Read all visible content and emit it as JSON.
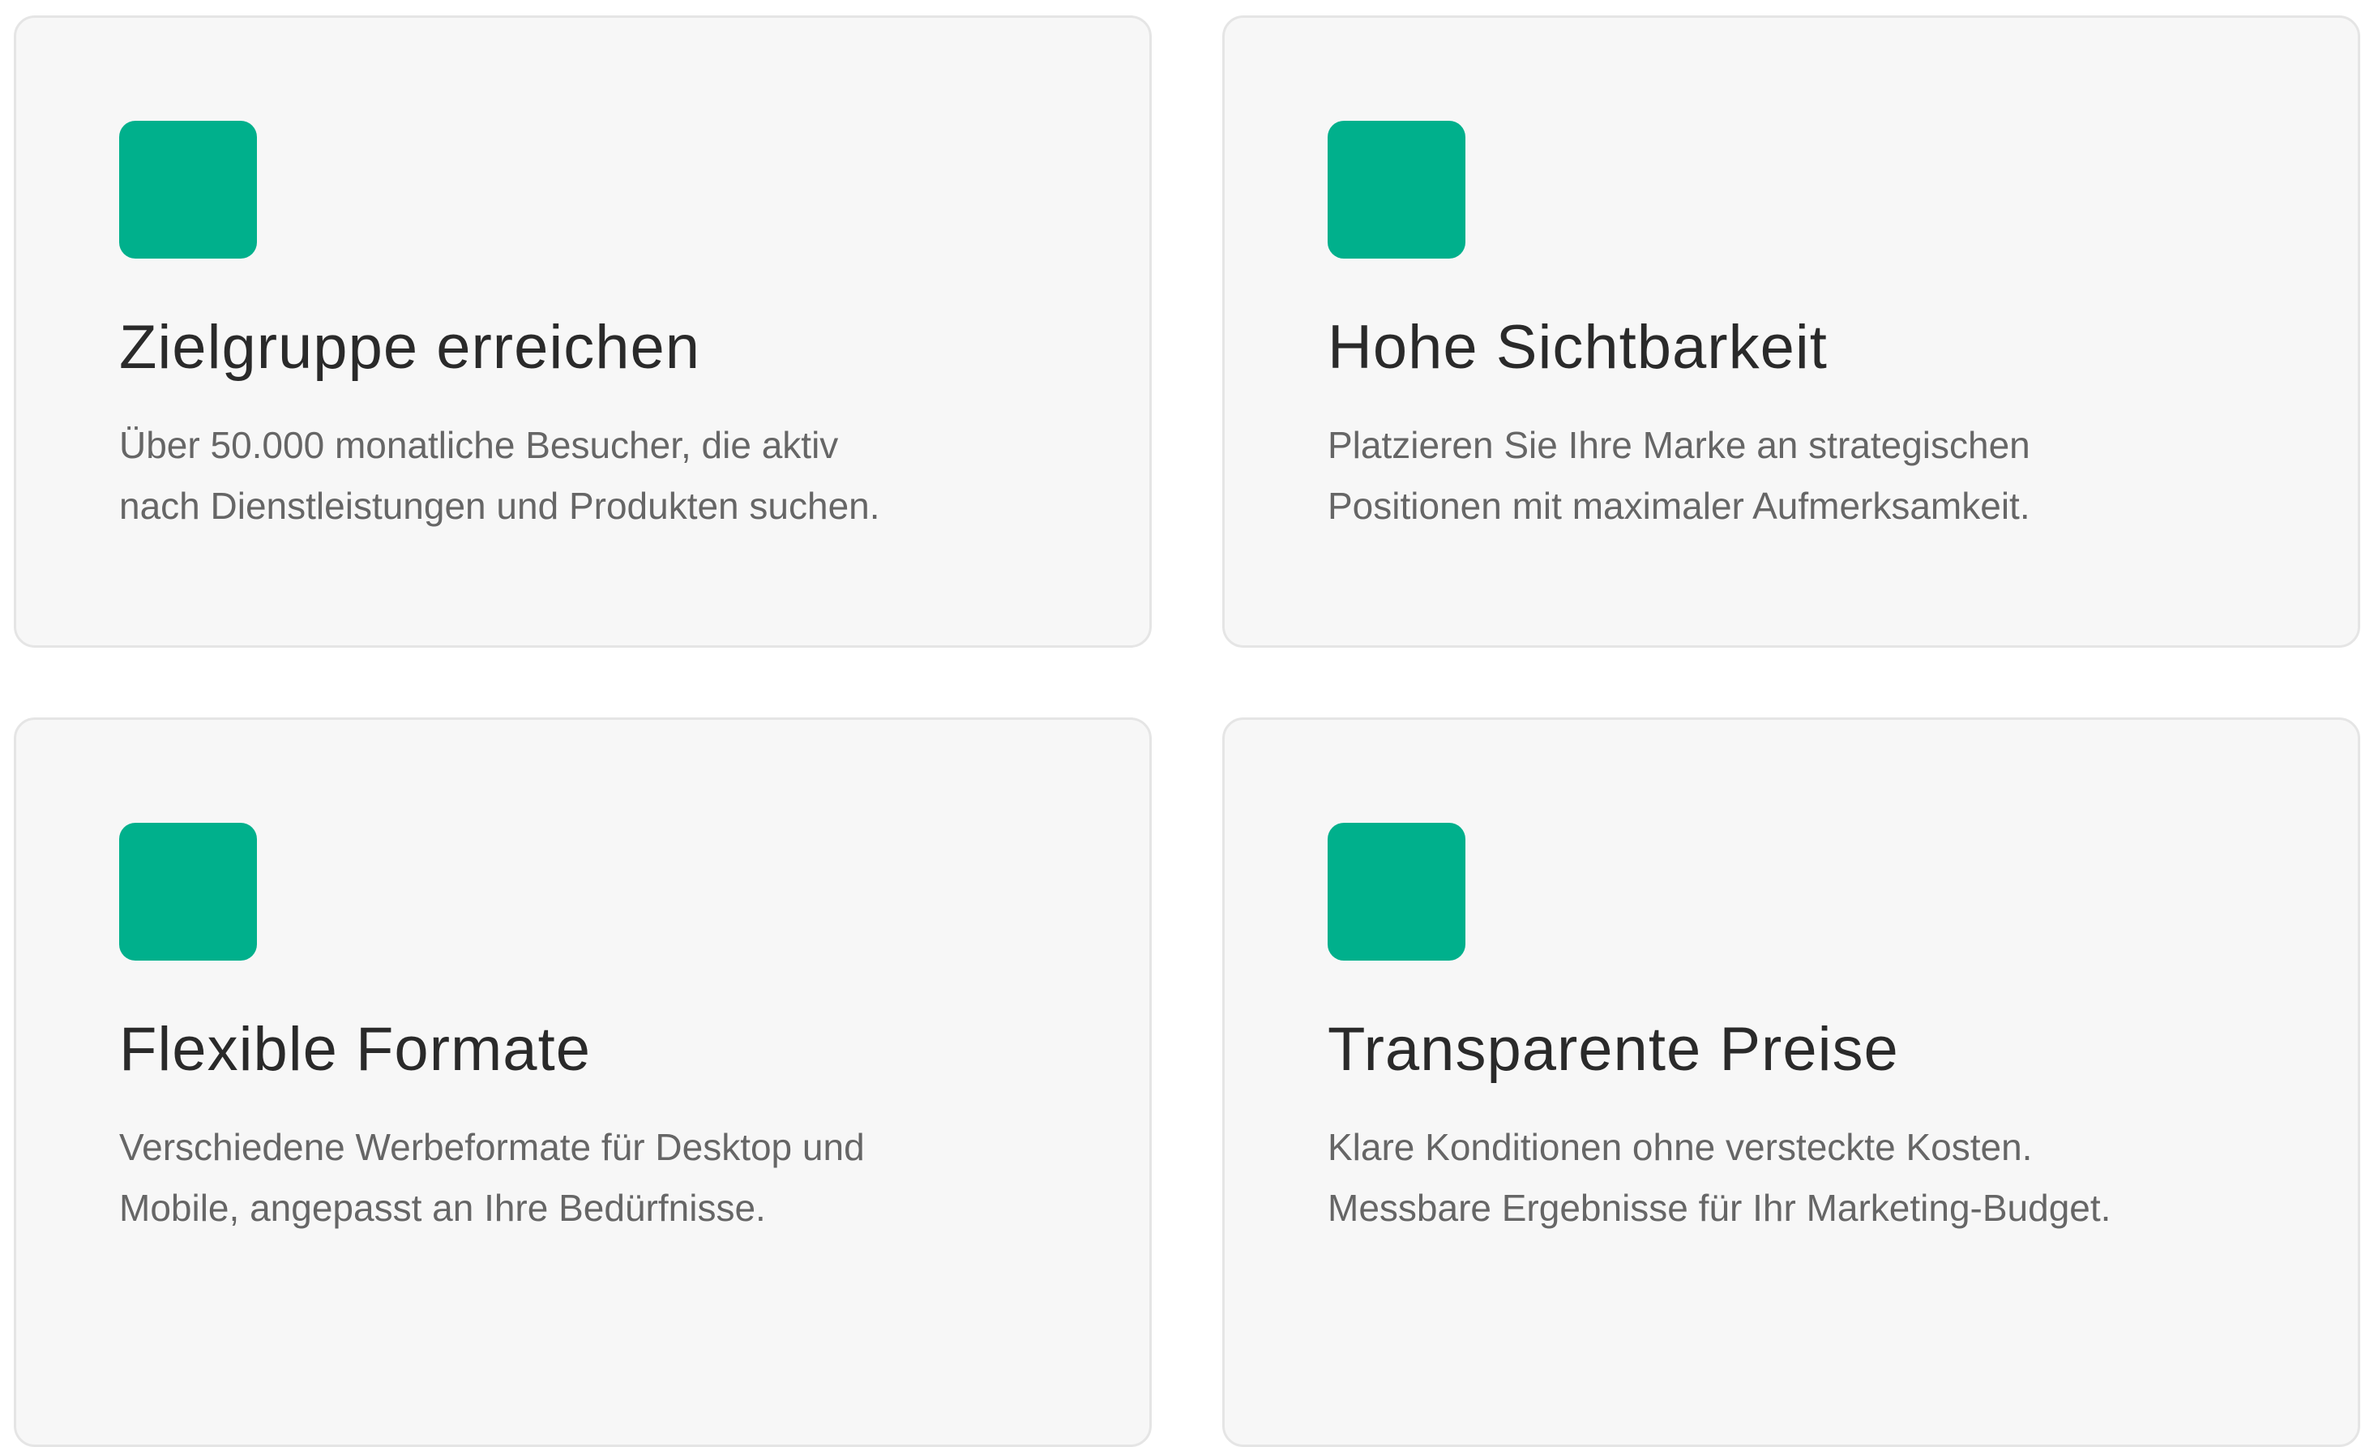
{
  "colors": {
    "accent": "#00b08c",
    "card_background": "#f7f7f7",
    "card_border": "#e5e5e5",
    "title_text": "#2a2a2a",
    "body_text": "#666666"
  },
  "features": [
    {
      "icon": "feature-icon",
      "title": "Zielgruppe erreichen",
      "description_line1": "Über 50.000 monatliche Besucher, die aktiv",
      "description_line2": "nach Dienstleistungen und Produkten suchen."
    },
    {
      "icon": "feature-icon",
      "title": "Hohe Sichtbarkeit",
      "description_line1": "Platzieren Sie Ihre Marke an strategischen",
      "description_line2": "Positionen mit maximaler Aufmerksamkeit."
    },
    {
      "icon": "feature-icon",
      "title": "Flexible Formate",
      "description_line1": "Verschiedene Werbeformate für Desktop und",
      "description_line2": "Mobile, angepasst an Ihre Bedürfnisse."
    },
    {
      "icon": "feature-icon",
      "title": "Transparente Preise",
      "description_line1": "Klare Konditionen ohne versteckte Kosten.",
      "description_line2": "Messbare Ergebnisse für Ihr Marketing-Budget."
    }
  ]
}
